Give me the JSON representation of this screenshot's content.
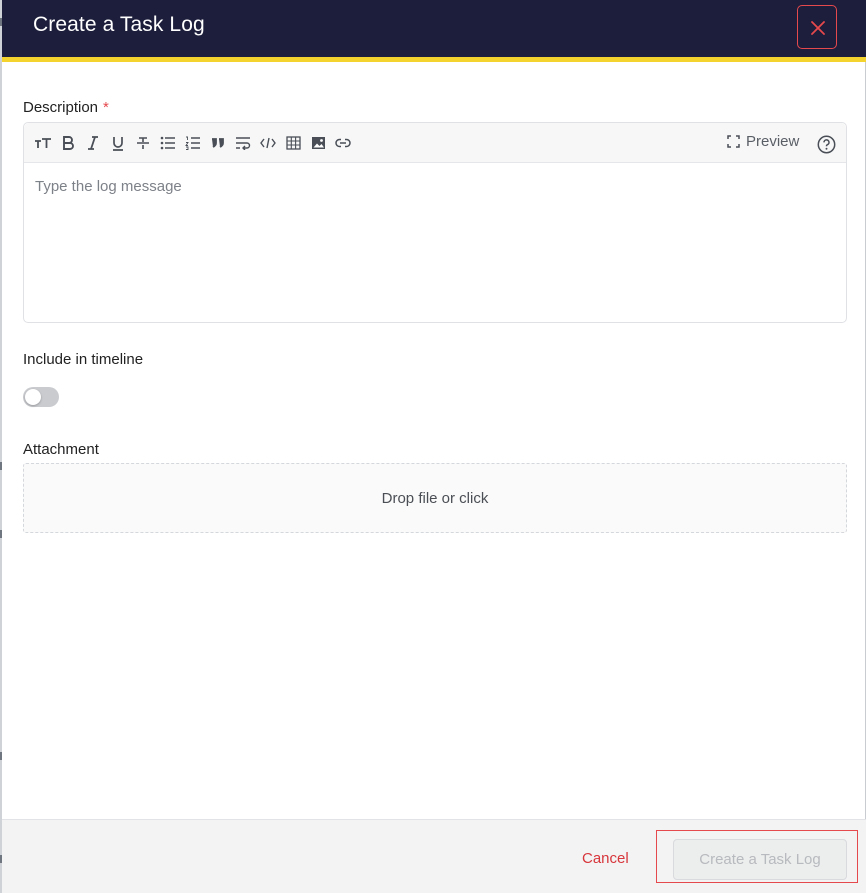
{
  "dialog": {
    "title": "Create a Task Log",
    "close_label": "Close"
  },
  "description": {
    "label": "Description",
    "required_mark": "*",
    "placeholder": "Type the log message",
    "value": ""
  },
  "toolbar": {
    "icons": [
      "text-size-icon",
      "bold-icon",
      "italic-icon",
      "underline-icon",
      "strikethrough-icon",
      "bullet-list-icon",
      "numbered-list-icon",
      "quote-icon",
      "wrap-text-icon",
      "code-icon",
      "table-icon",
      "image-icon",
      "link-icon"
    ],
    "preview_label": "Preview",
    "help_icon": "help-icon"
  },
  "timeline": {
    "label": "Include in timeline",
    "enabled": false
  },
  "attachment": {
    "label": "Attachment",
    "dropzone_text": "Drop file or click"
  },
  "footer": {
    "cancel_label": "Cancel",
    "submit_label": "Create a Task Log",
    "submit_enabled": false
  },
  "colors": {
    "header_bg": "#1c1e3b",
    "header_accent": "#f4d32f",
    "danger": "#e5484d"
  }
}
